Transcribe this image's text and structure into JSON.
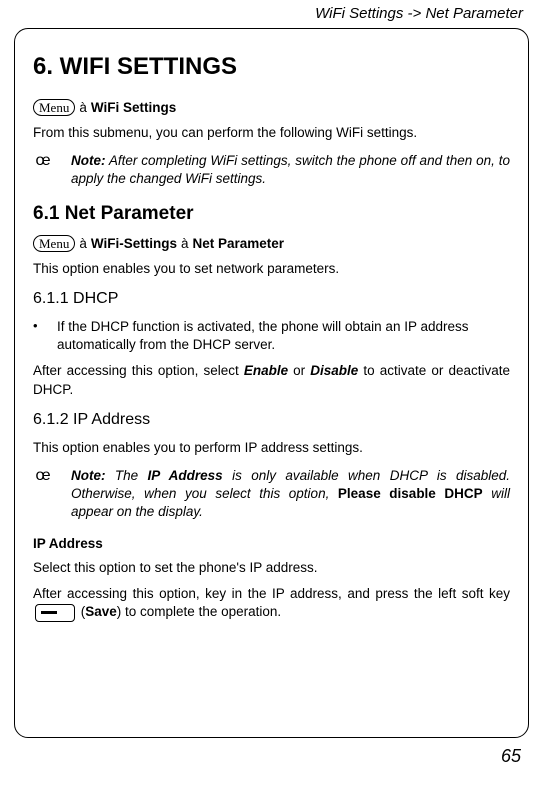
{
  "header": {
    "path": "WiFi Settings -> Net Parameter"
  },
  "h1": "6. WIFI SETTINGS",
  "menu_label": "Menu",
  "arrow": "à",
  "breadcrumb1": {
    "tail": "WiFi Settings"
  },
  "intro1": "From this submenu, you can perform the following WiFi settings.",
  "note1": {
    "marker": "œ",
    "label": "Note:",
    "text": " After completing WiFi settings, switch the phone off and then on, to apply the changed WiFi settings."
  },
  "h2_61": "6.1 Net Parameter",
  "breadcrumb2": {
    "part1": "WiFi-Settings",
    "part2": "Net Parameter"
  },
  "p_netparam": "This option enables you to set network parameters.",
  "h3_611": "6.1.1 DHCP",
  "bullet_dhcp": "If the DHCP function is activated, the phone will obtain an IP address automatically from the DHCP server.",
  "p_dhcp_pre": "After accessing this option, select ",
  "p_dhcp_enable": "Enable",
  "p_dhcp_mid": " or ",
  "p_dhcp_disable": "Disable",
  "p_dhcp_post": " to activate or deactivate DHCP.",
  "h3_612": "6.1.2 IP Address",
  "p_ip_intro": "This option enables you to perform IP address settings.",
  "note2": {
    "marker": "œ",
    "label": "Note:",
    "pre": " The ",
    "ipaddr": "IP Address",
    "mid": " is only available when DHCP is disabled. Otherwise, when you select this option, ",
    "bold": "Please disable DHCP",
    "post": " will appear on the display."
  },
  "subhead_ip": "IP Address",
  "p_selectip": "Select this option to set the phone's IP address.",
  "p_keyin_pre": "After accessing this option, key in the IP address, and press the left soft key ",
  "p_keyin_save": "Save",
  "p_keyin_post": ") to complete the operation.",
  "page_number": "65"
}
